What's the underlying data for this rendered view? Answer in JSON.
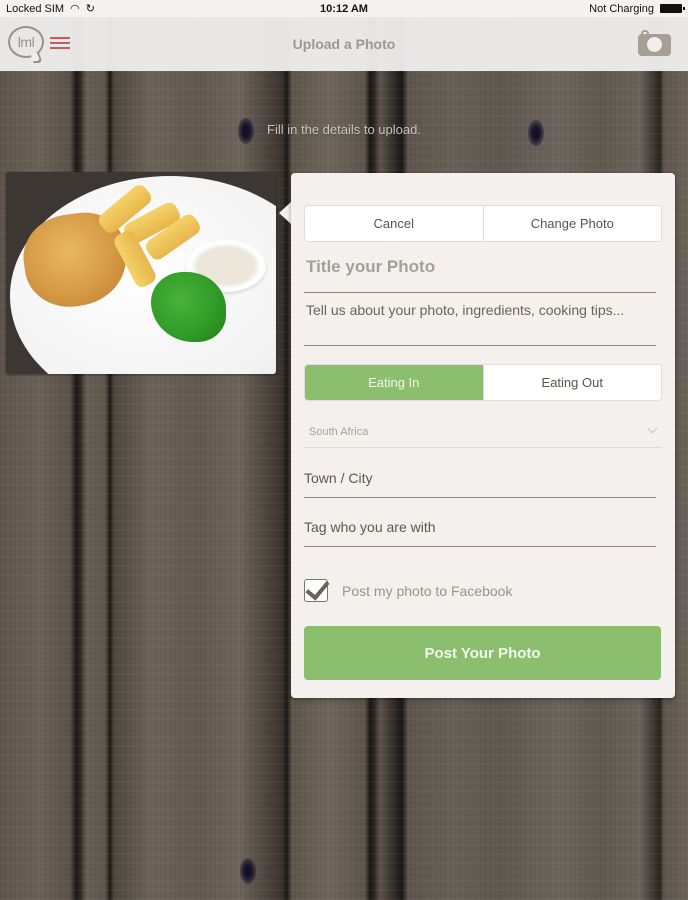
{
  "status_bar": {
    "carrier": "Locked SIM",
    "time": "10:12 AM",
    "battery_status": "Not Charging",
    "icons": [
      "wifi-icon",
      "sync-icon",
      "battery-icon"
    ]
  },
  "nav": {
    "logo_text": "lml",
    "title": "Upload a Photo",
    "icons": [
      "menu-icon",
      "camera-icon"
    ]
  },
  "hint": "Fill in the details to upload.",
  "photo": {
    "description": "Fish and chips with mushy peas and tartare sauce"
  },
  "form": {
    "top_buttons": {
      "cancel": "Cancel",
      "change_photo": "Change Photo"
    },
    "title_placeholder": "Title your Photo",
    "description_placeholder": "Tell us about your photo, ingredients, cooking tips...",
    "eating_toggle": {
      "options": [
        "Eating In",
        "Eating Out"
      ],
      "selected": "Eating In"
    },
    "country": "South Africa",
    "town_placeholder": "Town / City",
    "tag_placeholder": "Tag who you are with",
    "facebook": {
      "label": "Post my photo to Facebook",
      "checked": true
    },
    "submit_label": "Post Your Photo"
  },
  "colors": {
    "accent_green": "#8bbf6d",
    "menu_red": "#c0605c",
    "card_bg": "#f3f0ed"
  }
}
